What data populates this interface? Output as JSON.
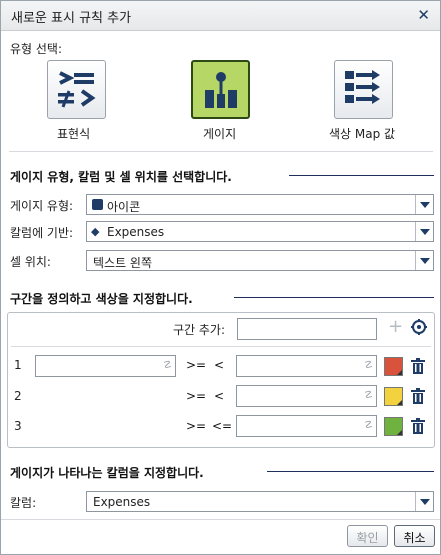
{
  "dialog": {
    "title": "새로운 표시 규칙 추가",
    "close_icon": "close-icon"
  },
  "type_select": {
    "label": "유형 선택:",
    "options": [
      {
        "label": "표현식",
        "icon": "expression-icon"
      },
      {
        "label": "게이지",
        "icon": "gauge-icon",
        "selected": true
      },
      {
        "label": "색상 Map 값",
        "icon": "color-map-icon"
      }
    ]
  },
  "gauge_section": {
    "heading": "게이지 유형, 칼럼 및 셀 위치를 선택합니다.",
    "gauge_type_label": "게이지 유형:",
    "gauge_type_value": "아이콘",
    "column_label": "칼럼에 기반:",
    "column_value": "Expenses",
    "cell_pos_label": "셀 위치:",
    "cell_pos_value": "텍스트 왼쪽"
  },
  "ranges_section": {
    "heading": "구간을 정의하고 색상을 지정합니다.",
    "add_range_label": "구간 추가:",
    "add_range_value": "",
    "rows": [
      {
        "num": "1",
        "op_left": ">=",
        "op_right": "<",
        "color": "#d9533c"
      },
      {
        "num": "2",
        "op_left": ">=",
        "op_right": "<",
        "color": "#f3d23f"
      },
      {
        "num": "3",
        "op_left": ">=",
        "op_right": "<=",
        "color": "#6fb23f"
      }
    ]
  },
  "columns_section": {
    "heading": "게이지가 나타나는 칼럼을 지정합니다.",
    "column_label": "칼럼:",
    "column_value": "Expenses"
  },
  "buttons": {
    "ok": "확인",
    "cancel": "취소"
  }
}
